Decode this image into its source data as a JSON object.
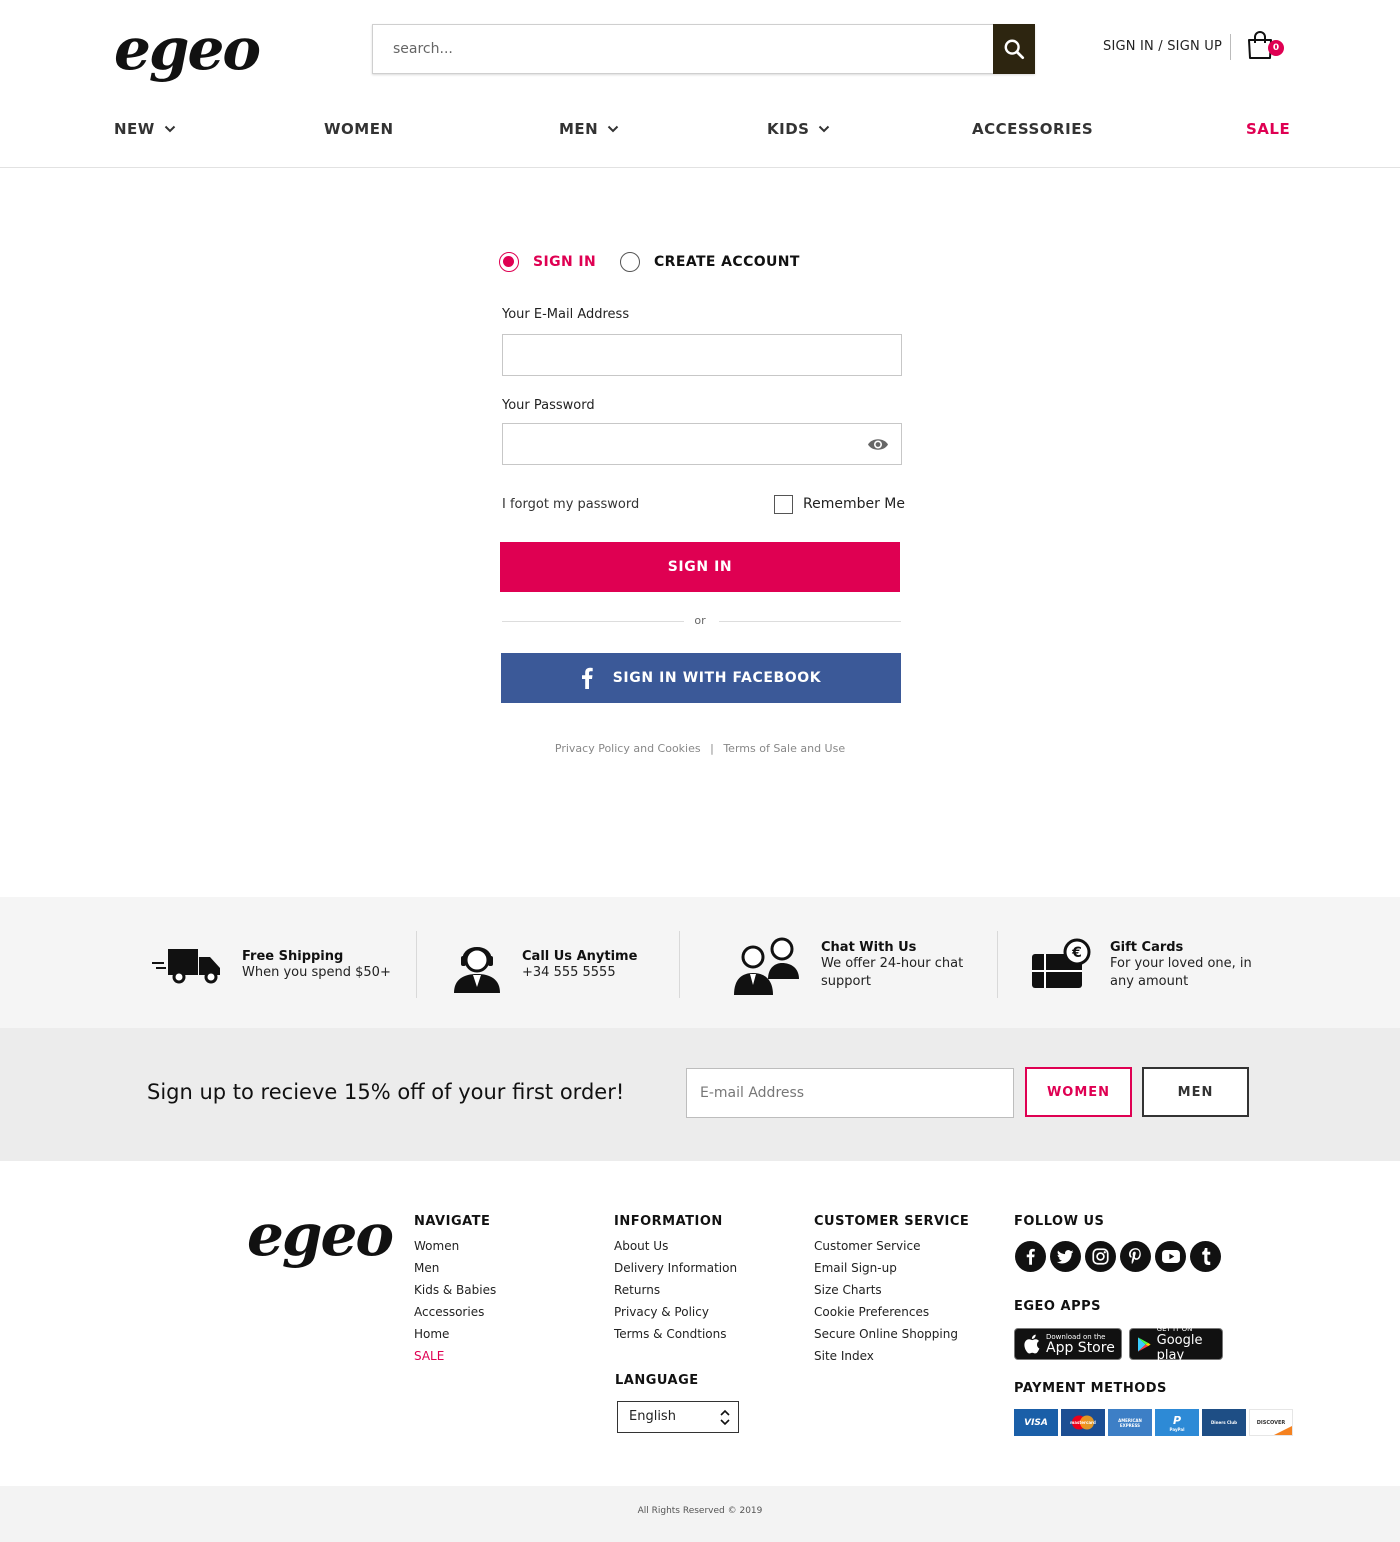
{
  "header": {
    "logo": "egeo",
    "search_placeholder": "search...",
    "signin_link": "SIGN IN / SIGN UP",
    "cart_count": "0"
  },
  "nav": {
    "items": [
      {
        "label": "NEW"
      },
      {
        "label": "WOMEN"
      },
      {
        "label": "MEN"
      },
      {
        "label": "KIDS"
      },
      {
        "label": "ACCESSORIES"
      },
      {
        "label": "SALE"
      }
    ]
  },
  "form": {
    "tab_signin": "SIGN IN",
    "tab_create": "CREATE ACCOUNT",
    "email_label": "Your E-Mail Address",
    "email_value": "",
    "password_label": "Your Password",
    "password_value": "",
    "forgot": "I forgot my password",
    "remember": "Remember Me",
    "signin_button": "SIGN IN",
    "or": "or",
    "facebook_button": "SIGN IN WITH FACEBOOK",
    "privacy_link": "Privacy Policy and Cookies",
    "separator": "|",
    "terms_link": "Terms of Sale and Use"
  },
  "features": [
    {
      "title": "Free Shipping",
      "text": "When you spend $50+"
    },
    {
      "title": "Call Us Anytime",
      "text": "+34 555 5555"
    },
    {
      "title": "Chat With Us",
      "text": "We offer 24-hour chat support"
    },
    {
      "title": "Gift Cards",
      "text": "For your loved one, in any amount"
    }
  ],
  "newsletter": {
    "title": "Sign up to recieve 15% off of your first order!",
    "placeholder": "E-mail Address",
    "women_button": "WOMEN",
    "men_button": "MEN"
  },
  "footer": {
    "logo": "egeo",
    "navigate": {
      "heading": "NAVIGATE",
      "items": [
        "Women",
        "Men",
        "Kids & Babies",
        "Accessories",
        "Home",
        "SALE"
      ]
    },
    "information": {
      "heading": "INFORMATION",
      "items": [
        "About Us",
        "Delivery Information",
        "Returns",
        "Privacy & Policy",
        "Terms & Condtions"
      ]
    },
    "customer_service": {
      "heading": "CUSTOMER SERVICE",
      "items": [
        "Customer Service",
        "Email Sign-up",
        "Size Charts",
        "Cookie Preferences",
        "Secure Online Shopping",
        "Site Index"
      ]
    },
    "language": {
      "heading": "LANGUAGE",
      "selected": "English"
    },
    "follow_heading": "FOLLOW US",
    "social": [
      "facebook-icon",
      "twitter-icon",
      "instagram-icon",
      "pinterest-icon",
      "youtube-icon",
      "tumblr-icon"
    ],
    "apps_heading": "EGEO APPS",
    "app_store": {
      "small": "Download on the",
      "big": "App Store"
    },
    "google_play": {
      "small": "GET IT ON",
      "big": "Google play"
    },
    "payment_heading": "PAYMENT METHODS",
    "payment_methods": [
      {
        "name": "VISA",
        "color": "#1a5fa8"
      },
      {
        "name": "mastercard",
        "color": "#1c4e93"
      },
      {
        "name": "AMERICAN EXPRESS",
        "color": "#3d7fc6"
      },
      {
        "name": "PayPal",
        "color": "#2d8ad6"
      },
      {
        "name": "Diners Club",
        "color": "#1e4e85"
      },
      {
        "name": "DISCOVER",
        "color": "#ffffff"
      }
    ]
  },
  "copyright": "All Rights Reserved © 2019",
  "colors": {
    "accent": "#df0052",
    "facebook": "#3b5998",
    "search_button": "#2d2510"
  }
}
